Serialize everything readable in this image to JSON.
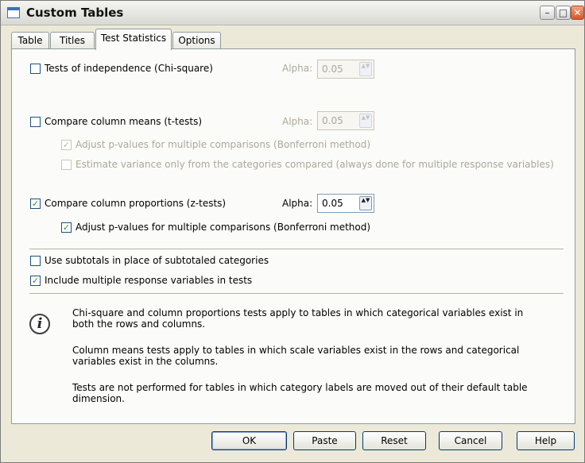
{
  "window": {
    "title": "Custom Tables",
    "minimize_glyph": "–",
    "maximize_glyph": "□",
    "close_glyph": "✕"
  },
  "tabs": [
    {
      "label": "Table",
      "active": false
    },
    {
      "label": "Titles",
      "active": false
    },
    {
      "label": "Test Statistics",
      "active": true
    },
    {
      "label": "Options",
      "active": false
    }
  ],
  "independence": {
    "label": "Tests of independence (Chi-square)",
    "checked": false,
    "alpha_label": "Alpha:",
    "alpha_value": "0.05",
    "enabled": false
  },
  "means": {
    "label": "Compare column means (t-tests)",
    "checked": false,
    "alpha_label": "Alpha:",
    "alpha_value": "0.05",
    "enabled": false,
    "adjust_label": "Adjust p-values for multiple comparisons (Bonferroni method)",
    "adjust_checked": true,
    "estimate_label": "Estimate variance only from the categories compared (always done for multiple response variables)",
    "estimate_checked": false
  },
  "proportions": {
    "label": "Compare column proportions (z-tests)",
    "checked": true,
    "alpha_label": "Alpha:",
    "alpha_value": "0.05",
    "enabled": true,
    "adjust_label": "Adjust p-values for multiple comparisons (Bonferroni method)",
    "adjust_checked": true
  },
  "subtotals": {
    "label": "Use subtotals in place of subtotaled categories",
    "checked": false
  },
  "multiple_response": {
    "label": "Include multiple response variables in tests",
    "checked": true
  },
  "info": {
    "icon": "info-icon",
    "paragraphs": [
      "Chi-square and column proportions tests apply to tables in which categorical variables exist in both the rows and columns.",
      "Column means tests apply to tables in which scale variables exist in the rows and categorical variables exist in the columns.",
      "Tests are not performed for tables in which category labels are moved out of their default table dimension."
    ]
  },
  "buttons": {
    "ok": "OK",
    "paste": "Paste",
    "reset": "Reset",
    "cancel": "Cancel",
    "help": "Help"
  },
  "glyphs": {
    "check": "✓",
    "spin": "▲▼"
  }
}
